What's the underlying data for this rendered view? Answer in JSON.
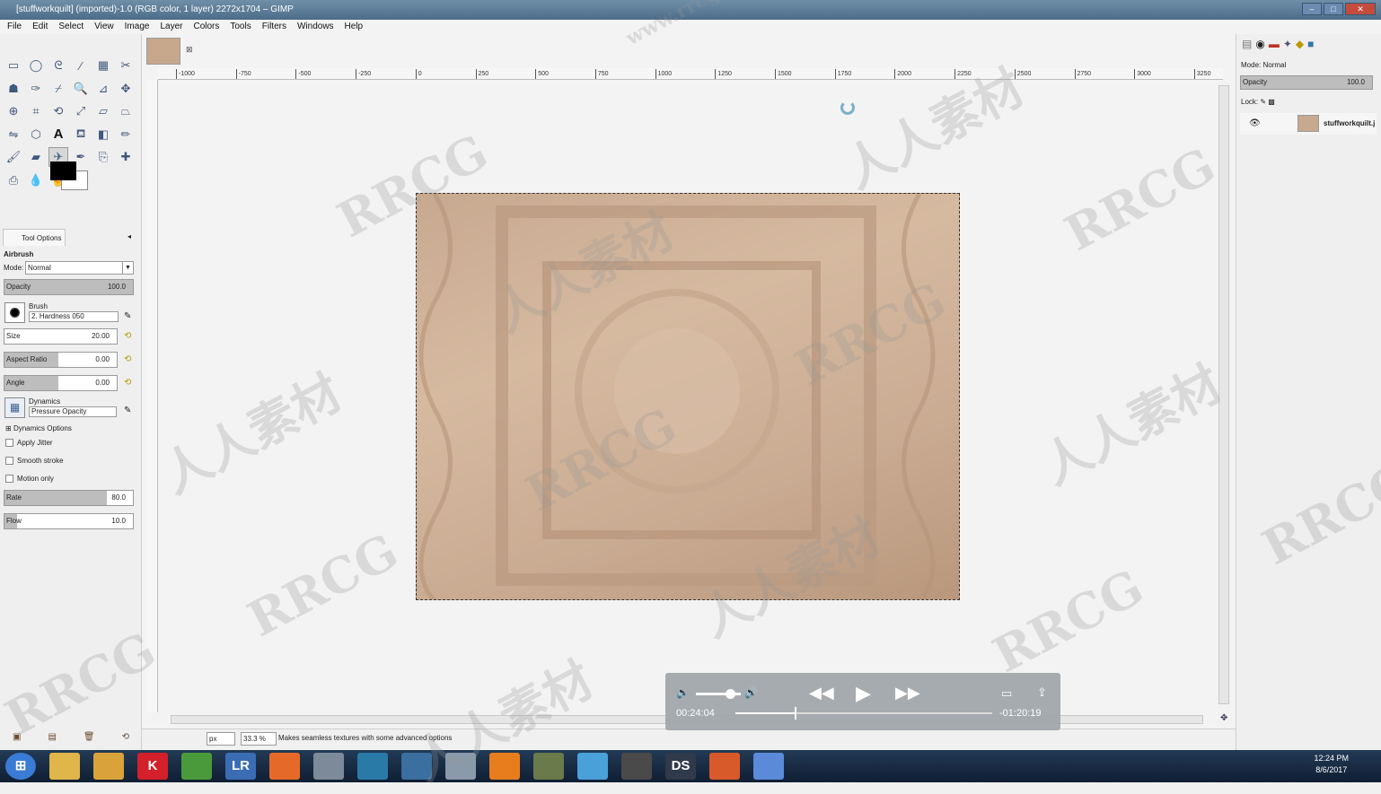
{
  "window": {
    "title": "[stuffworkquilt] (imported)-1.0 (RGB color, 1 layer) 2272x1704 – GIMP",
    "controls": [
      "–",
      "□",
      "✕"
    ]
  },
  "menu": [
    "File",
    "Edit",
    "Select",
    "View",
    "Image",
    "Layer",
    "Colors",
    "Tools",
    "Filters",
    "Windows",
    "Help"
  ],
  "toolbox": {
    "tools": [
      "rect-select-icon",
      "ellipse-select-icon",
      "lasso-icon",
      "fuzzy-select-icon",
      "color-select-icon",
      "scissors-icon",
      "foreground-select-icon",
      "paths-icon",
      "color-picker-icon",
      "zoom-icon",
      "measure-icon",
      "move-icon",
      "align-icon",
      "crop-icon",
      "rotate-icon",
      "scale-icon",
      "shear-icon",
      "perspective-icon",
      "flip-icon",
      "cage-icon",
      "text-icon",
      "bucket-fill-icon",
      "blend-icon",
      "pencil-icon",
      "paintbrush-icon",
      "eraser-icon",
      "airbrush-icon",
      "ink-icon",
      "clone-icon",
      "heal-icon",
      "perspective-clone-icon",
      "blur-icon",
      "smudge-icon",
      "dodge-burn-icon"
    ],
    "active_tool": "airbrush-icon",
    "fg_color": "#000000",
    "bg_color": "#ffffff"
  },
  "tool_options": {
    "tab": "Tool Options",
    "tool_name": "Airbrush",
    "mode_label": "Mode:",
    "mode": "Normal",
    "opacity_label": "Opacity",
    "opacity": "100.0",
    "opacity_pct": 100,
    "brush_label": "Brush",
    "brush": "2. Hardness 050",
    "size_label": "Size",
    "size": "20.00",
    "aspect_label": "Aspect Ratio",
    "aspect": "0.00",
    "angle_label": "Angle",
    "angle": "0.00",
    "dynamics_label": "Dynamics",
    "dynamics": "Pressure Opacity",
    "dynamics_options": "Dynamics Options",
    "apply_jitter": "Apply Jitter",
    "smooth_stroke": "Smooth stroke",
    "motion_only": "Motion only",
    "rate_label": "Rate",
    "rate": "80.0",
    "rate_pct": 80,
    "flow_label": "Flow",
    "flow": "10.0",
    "flow_pct": 10
  },
  "ruler": {
    "top_ticks": [
      "-1000",
      "-750",
      "-500",
      "-250",
      "0",
      "250",
      "500",
      "750",
      "1000",
      "1250",
      "1500",
      "1750",
      "2000",
      "2250",
      "2500",
      "2750",
      "3000",
      "3250"
    ]
  },
  "status": {
    "unit": "px",
    "zoom": "33.3 %",
    "message": "Makes seamless textures with some advanced options"
  },
  "layers": {
    "mode_label": "Mode:",
    "mode": "Normal",
    "opacity_label": "Opacity",
    "opacity": "100.0",
    "lock_label": "Lock:",
    "layer_name": "stuffworkquilt.j"
  },
  "player": {
    "elapsed": "00:24:04",
    "remaining": "-01:20:19",
    "progress": 0.23,
    "volume": 0.75
  },
  "taskbar": {
    "apps": [
      "start",
      "explorer",
      "media",
      "K",
      "chrome",
      "LR",
      "firefox",
      "files",
      "app9",
      "app10",
      "app11",
      "blender",
      "app13",
      "app14",
      "gimp",
      "DS",
      "app17",
      "app18"
    ],
    "time": "12:24 PM",
    "date": "8/6/2017"
  },
  "watermarks": [
    "www.rrcg.cn",
    "RRCG",
    "人人素材"
  ]
}
